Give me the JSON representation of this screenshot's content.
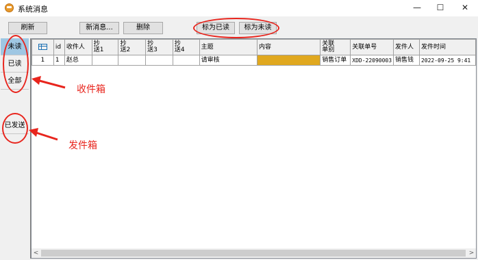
{
  "window": {
    "title": "系统消息",
    "minimize": "—",
    "maximize": "☐",
    "close": "✕"
  },
  "toolbar": {
    "refresh": "刷新",
    "new_message": "新消息...",
    "delete": "删除",
    "mark_read": "标为已读",
    "mark_unread": "标为未读"
  },
  "sidebar": {
    "unread": "未读",
    "read": "已读",
    "all": "全部",
    "sent": "已发送"
  },
  "grid": {
    "columns": [
      "",
      "id",
      "收件人",
      "抄\n送1",
      "抄\n送2",
      "抄\n送3",
      "抄\n送4",
      "主题",
      "内容",
      "关联\n单别",
      "关联单号",
      "发件人",
      "发件时间"
    ],
    "rows": [
      [
        "1",
        "1",
        "赵总",
        "",
        "",
        "",
        "",
        "请审核",
        "",
        "销售订单",
        "XDD-22090003",
        "销售钱",
        "2022-09-25 9:41"
      ]
    ]
  },
  "annotations": {
    "inbox": "收件箱",
    "outbox": "发件箱"
  },
  "colors": {
    "highlight_cell": "#e0a81f",
    "active_tab": "#9fc7e3",
    "annotation": "#e8251d"
  }
}
